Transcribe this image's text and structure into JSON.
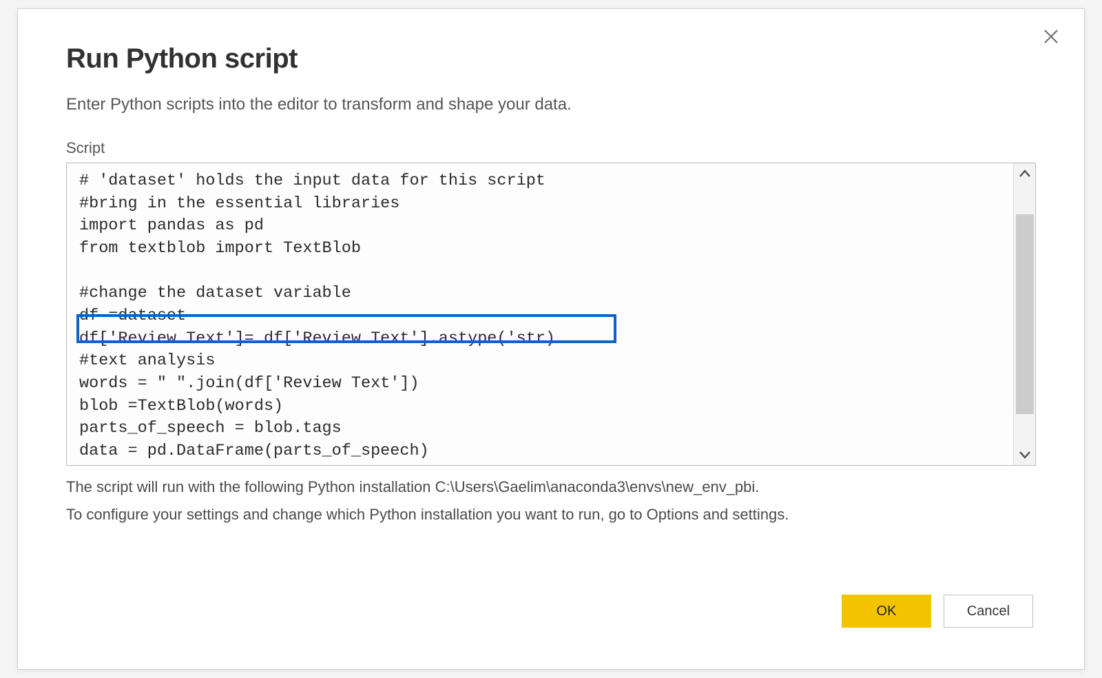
{
  "dialog": {
    "title": "Run Python script",
    "subtitle": "Enter Python scripts into the editor to transform and shape your data.",
    "script_label": "Script",
    "script_lines": [
      "# 'dataset' holds the input data for this script",
      "#bring in the essential libraries",
      "import pandas as pd",
      "from textblob import TextBlob",
      "",
      "#change the dataset variable",
      "df =dataset",
      "df['Review Text']= df['Review Text'].astype('str)",
      "#text analysis",
      "words = \" \".join(df['Review Text'])",
      "blob =TextBlob(words)",
      "parts_of_speech = blob.tags",
      "data = pd.DataFrame(parts_of_speech)"
    ],
    "info_line_1": "The script will run with the following Python installation C:\\Users\\Gaelim\\anaconda3\\envs\\new_env_pbi.",
    "info_line_2": "To configure your settings and change which Python installation you want to run, go to Options and settings.",
    "ok_label": "OK",
    "cancel_label": "Cancel",
    "highlighted_line_index": 7
  }
}
